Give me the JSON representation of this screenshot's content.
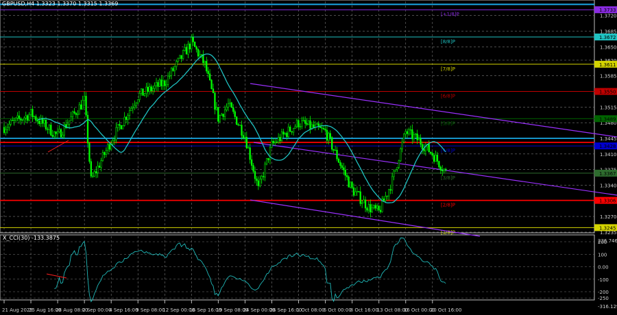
{
  "window": {
    "symbol_title": "GBPUSD,H4  1.3323 1.3370 1.3315 1.3369",
    "indicator_title": "X_CCI(30) -133.3875"
  },
  "colors": {
    "background": "#000000",
    "bull_candle": "#00ff00",
    "bear_candle": "#00ff00",
    "moving_average": "#1fc2c2",
    "channel": "#9b30ff",
    "cci_line": "#1fb8b8",
    "grid": "#8a8a8a"
  },
  "chart_data": [
    {
      "type": "candlestick",
      "symbol": "GBPUSD",
      "timeframe": "H4",
      "last_bar": {
        "open": 1.3323,
        "high": 1.337,
        "low": 1.3315,
        "close": 1.3369
      },
      "price_axis_labels": [
        "1.3720",
        "1.3685",
        "1.3650",
        "1.3620",
        "1.3585",
        "1.3515",
        "1.3480",
        "1.3445",
        "1.3410",
        "1.3375",
        "1.3340",
        "1.3270",
        "1.3235"
      ],
      "ylim": [
        1.3222,
        1.3752
      ],
      "time_axis_labels": [
        "21 Aug 2025",
        "25 Aug 16:00",
        "28 Aug 08:00",
        "2 Sep 00:00",
        "4 Sep 16:00",
        "9 Sep 08:00",
        "12 Sep 00:00",
        "16 Sep 16:00",
        "19 Sep 08:00",
        "24 Sep 00:00",
        "26 Sep 16:00",
        "1 Oct 08:00",
        "6 Oct 00:00",
        "8 Oct 16:00",
        "13 Oct 08:00",
        "16 Oct 00:00",
        "20 Oct 16:00"
      ],
      "price_path": [
        [
          "21 Aug 2025",
          1.347
        ],
        [
          "25 Aug 16:00",
          1.35
        ],
        [
          "28 Aug 08:00",
          1.345
        ],
        [
          "2 Sep 00:00",
          1.353
        ],
        [
          "2 Sep 16:00",
          1.335
        ],
        [
          "4 Sep 16:00",
          1.344
        ],
        [
          "9 Sep 08:00",
          1.354
        ],
        [
          "12 Sep 00:00",
          1.357
        ],
        [
          "16 Sep 16:00",
          1.366
        ],
        [
          "18 Sep 00:00",
          1.361
        ],
        [
          "19 Sep 08:00",
          1.349
        ],
        [
          "22 Sep 08:00",
          1.352
        ],
        [
          "24 Sep 00:00",
          1.345
        ],
        [
          "25 Sep 08:00",
          1.333
        ],
        [
          "26 Sep 16:00",
          1.343
        ],
        [
          "1 Oct 08:00",
          1.348
        ],
        [
          "6 Oct 00:00",
          1.346
        ],
        [
          "8 Oct 16:00",
          1.333
        ],
        [
          "10 Oct 08:00",
          1.329
        ],
        [
          "13 Oct 08:00",
          1.328
        ],
        [
          "14 Oct 16:00",
          1.335
        ],
        [
          "16 Oct 00:00",
          1.346
        ],
        [
          "17 Oct 08:00",
          1.344
        ],
        [
          "20 Oct 16:00",
          1.341
        ],
        [
          "22 Oct 00:00",
          1.3369
        ]
      ],
      "levels": [
        {
          "label": "[+1/8]P",
          "value": "1.3733",
          "color": "#8a2be2"
        },
        {
          "label": "[8/8]P",
          "value": "1.3672",
          "color": "#1fc2c2"
        },
        {
          "label": "[7/8]P",
          "value": "1.3611",
          "color": "#d4d400"
        },
        {
          "label": "[6/8]P",
          "value": "1.3550",
          "color": "#c00000"
        },
        {
          "label": "[5/8]P",
          "value": "1.3489",
          "color": "#006400"
        },
        {
          "label": "[4/8]P",
          "value": "1.3428",
          "color": "#0000cd"
        },
        {
          "label": "[3/8]P",
          "value": "1.3367",
          "color": "#2e6b2e"
        },
        {
          "label": "[2/8]P",
          "value": "1.3306",
          "color": "#ff0000"
        },
        {
          "label": "[1/8]P",
          "value": "1.3245",
          "color": "#d4d400"
        }
      ],
      "extra_lines": [
        {
          "value": "1.3436",
          "color": "#ff0000"
        },
        {
          "value": "1.3445",
          "color": "#19a9e6"
        },
        {
          "value": "1.3745",
          "color": "#19a9e6"
        }
      ]
    },
    {
      "type": "line",
      "name": "X_CCI(30)",
      "current": -133.3875,
      "axis_labels": [
        "236.7464",
        "200",
        "100",
        "0.00",
        "-100",
        "-200",
        "-250",
        "-316.129"
      ],
      "ylim": [
        -316.129,
        236.7464
      ]
    }
  ]
}
